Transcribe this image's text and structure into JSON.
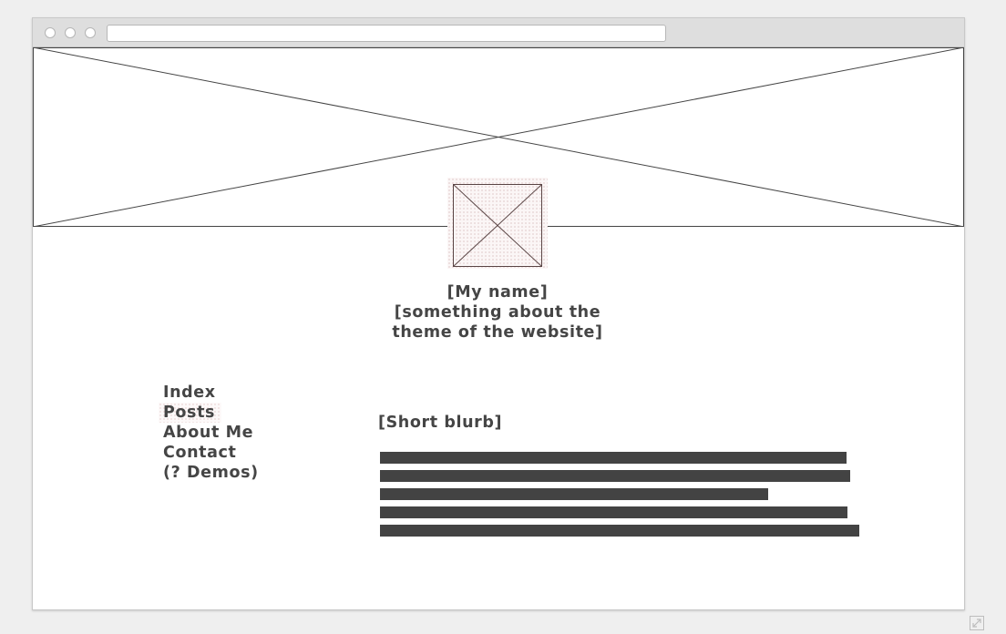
{
  "window": {
    "controls": [
      "close-dot",
      "minimize-dot",
      "maximize-dot"
    ],
    "url": ""
  },
  "header": {
    "name": "[My name]",
    "tagline_line1": "[something about the",
    "tagline_line2": "theme of the website]"
  },
  "nav": {
    "items": [
      {
        "label": "Index"
      },
      {
        "label": "Posts"
      },
      {
        "label": "About Me"
      },
      {
        "label": "Contact"
      },
      {
        "label": "(? Demos)"
      }
    ],
    "active": "Posts"
  },
  "main": {
    "blurb_title": "[Short blurb]"
  },
  "colors": {
    "text": "#454545",
    "placeholder_bar": "#434343",
    "highlight_dots": "#d4b0b0"
  },
  "icons": [
    "banner-image-placeholder-icon",
    "avatar-image-placeholder-icon",
    "resize-icon"
  ]
}
